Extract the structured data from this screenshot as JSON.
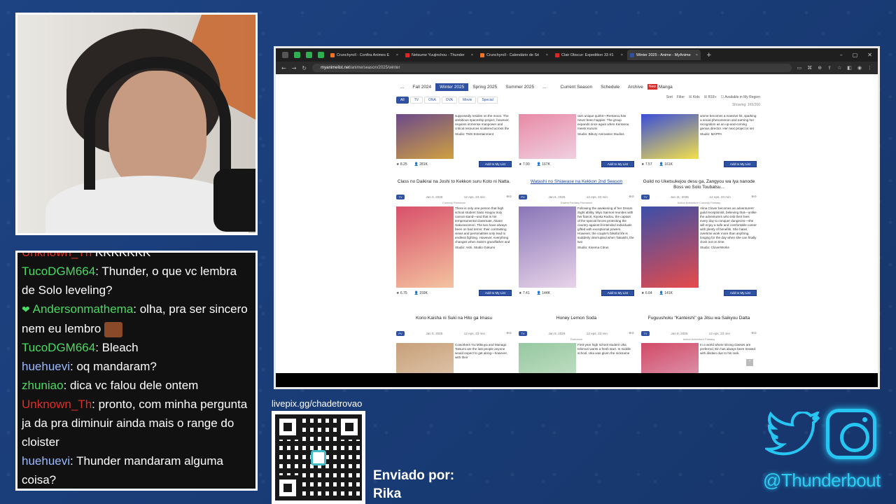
{
  "chat": {
    "lines": [
      {
        "user": "Unknown_Th",
        "user_class": "u-red",
        "text": " KKKKKKK"
      },
      {
        "user": "TucoDGM664",
        "user_class": "u-green",
        "text": ": Thunder, o que vc lembra de Solo leveling?"
      },
      {
        "user": "Andersonmathema",
        "user_class": "u-green",
        "text": ": olha, pra ser sincero nem eu lembro",
        "emote": true,
        "badge": true
      },
      {
        "user": "TucoDGM664",
        "user_class": "u-green",
        "text": ": Bleach"
      },
      {
        "user": "huehuevi",
        "user_class": "u-blue",
        "text": ": oq mandaram?"
      },
      {
        "user": "zhuniao",
        "user_class": "u-green",
        "text": ": dica vc falou dele ontem"
      },
      {
        "user": "Unknown_Th",
        "user_class": "u-red",
        "text": ": pronto, com minha pergunta ja da pra diminuir ainda mais o range do cloister"
      },
      {
        "user": "huehuevi",
        "user_class": "u-blue",
        "text": ": Thunder mandaram alguma coisa?"
      }
    ]
  },
  "livepix": {
    "title": "livepix.gg/chadetrovao"
  },
  "sent_by": {
    "label": "Enviado por:",
    "name": "Rika"
  },
  "social": {
    "handle": "@Thunderbout"
  },
  "browser": {
    "tabs": [
      {
        "label": "Crunchyroll - Confira Animes E",
        "color": "#f47521"
      },
      {
        "label": "Netsume Yuujinchou - Thunder",
        "color": "#e02424"
      },
      {
        "label": "Crunchyroll - Calendário de Sé",
        "color": "#f47521"
      },
      {
        "label": "Clair Obscur: Expedition 33 #1",
        "color": "#e02424"
      },
      {
        "label": "Winter 2025 - Anime - MyAnime",
        "color": "#2e51a2",
        "active": true
      }
    ],
    "url_host": "myanimelist.net",
    "url_path": "/anime/season/2025/winter",
    "season_nav": {
      "ellipsis": "...",
      "items": [
        "Fall 2024",
        "Winter 2025",
        "Spring 2025",
        "Summer 2025"
      ],
      "active_index": 1,
      "ellipsis_after": "...",
      "current": "Current Season",
      "schedule": "Schedule",
      "archive": "Archive",
      "new_badge": "New",
      "manga": "Manga"
    },
    "type_filter": [
      "All",
      "TV",
      "ONA",
      "OVA",
      "Movie",
      "Special"
    ],
    "sort": {
      "sort": "Sort",
      "filter": "Filter",
      "kids": "Kids",
      "r18": "R18+",
      "region": "Available in My Region"
    },
    "showing": "Showing: 165/260",
    "cards_row0": [
      {
        "synopsis": "supposedly resides on the moon. The ambitious spaceship project, however, requires immense manpower and critical resources scattered across the",
        "studio": "Studio: TMS Entertainment",
        "score": "8.25",
        "members": "281K",
        "add": "Add to My List",
        "img": [
          "#6b4a8a",
          "#d0a040"
        ]
      },
      {
        "synopsis": "own unique quirks—Rentarou has never been happier. The group expands once again when Kentarou meets Kurumi",
        "studio": "Studio: Bibury Animation Studios",
        "score": "7.90",
        "members": "167K",
        "add": "Add to My List",
        "img": [
          "#e88aa6",
          "#f0d0e0"
        ]
      },
      {
        "synopsis": "anime becomes a massive hit, sparking a social phenomenon and earning her recognition as an up-and-coming genius director. Her next project is set",
        "studio": "Studio: MAPPA",
        "score": "7.57",
        "members": "161K",
        "add": "Add to My List",
        "img": [
          "#3a4fd8",
          "#f3e04a"
        ]
      }
    ],
    "cards_row1": [
      {
        "title": "Class no Daikirai na Joshi to Kekkon suru Koto ni Natta.",
        "badge": "TV",
        "date": "Jan 3, 2025",
        "eps": "12 eps, 23 min",
        "genres": "Comedy  Romance",
        "synopsis": "There is only one person that high school student Saito Houjou truly cannot stand—and that is his temperamental classmate, Akane Sakuranomori. The two have always been on bad terms: their contrasting views and personalities only lead to endless fighting. However, everything changes when Saito's grandfather and",
        "studio": "Studio: Ashi, Studio Gokumi",
        "score": "6.75",
        "members": "159K",
        "add": "Add to My List",
        "img": [
          "#d8506a",
          "#f4c3a0"
        ]
      },
      {
        "title": "Watashi no Shiawase na Kekkon 2nd Season",
        "badge": "PV",
        "date": "Jan 6, 2025",
        "eps": "12 eps, 23 min",
        "genres": "Drama  Fantasy  Romance",
        "synopsis": "Following the awakening of her Dream Sight ability, Miyo Saimori reunites with her fiancé, Kiyoka Kudou, the captain of the special forces protecting the country against ill-intended individuals gifted with exceptional powers. However, the couple's blissful life is suddenly interrupted when Takaishi, the two",
        "studio": "Studio: Kinema Citrus",
        "score": "7.41",
        "members": "144K",
        "add": "Add to My List",
        "img": [
          "#8a76b8",
          "#e8d4e8"
        ]
      },
      {
        "title": "Guild no Uketsukejou desu ga, Zangyou wa Iya nanode Boss wo Solo Toubatsu...",
        "badge": "TV",
        "date": "Jan 11, 2025",
        "eps": "12 eps, 23 min",
        "genres": "Action  Adventure  Comedy  Fantasy",
        "synopsis": "Alina Clover becomes an adventurers' guild receptionist, believing that—unlike the adventurers who risk their lives every day to conquer dungeons—she will enjoy a safe and comfortable career with plenty of benefits. She hates overtime work more than anything, longing for the day when she can finally clock out on time.",
        "studio": "Studio: CloverWorks",
        "score": "6.64",
        "members": "141K",
        "add": "Add to My List",
        "img": [
          "#3b4fa8",
          "#e64b4b"
        ]
      }
    ],
    "cards_row2": [
      {
        "title": "Kono Kaisha ni Suki na Hito ga Imasu",
        "badge": "PV",
        "date": "Jan 6, 2025",
        "eps": "12 eps, 23 min",
        "genres": "",
        "synopsis": "Coworkers Yui Mitsuya and Manago Tatsumi are the last people anyone would expect to get along—however, with their",
        "img": [
          "#c8a07a",
          "#efe2cf"
        ]
      },
      {
        "title": "Honey Lemon Soda",
        "badge": "TV",
        "date": "Jan 8, 2025",
        "eps": "12 eps, 23 min",
        "genres": "Romance",
        "synopsis": "First-year high school student Uka Ishimori wants a fresh start. In middle school, Uka was given the nickname",
        "img": [
          "#96c8a0",
          "#e2f0e0"
        ]
      },
      {
        "title": "Fuguushoku \"Kanteishi\" ga Jitsu wa Saikyou Datta",
        "badge": "TV",
        "date": "Jan 9, 2025",
        "eps": "12 eps, 23 min",
        "genres": "Action  Adventure  Fantasy",
        "synopsis": "In a world where strong classes are preferred, Ein has always been treated with disdain due to his rank.",
        "img": [
          "#d24a66",
          "#e6d0e6"
        ]
      }
    ]
  }
}
